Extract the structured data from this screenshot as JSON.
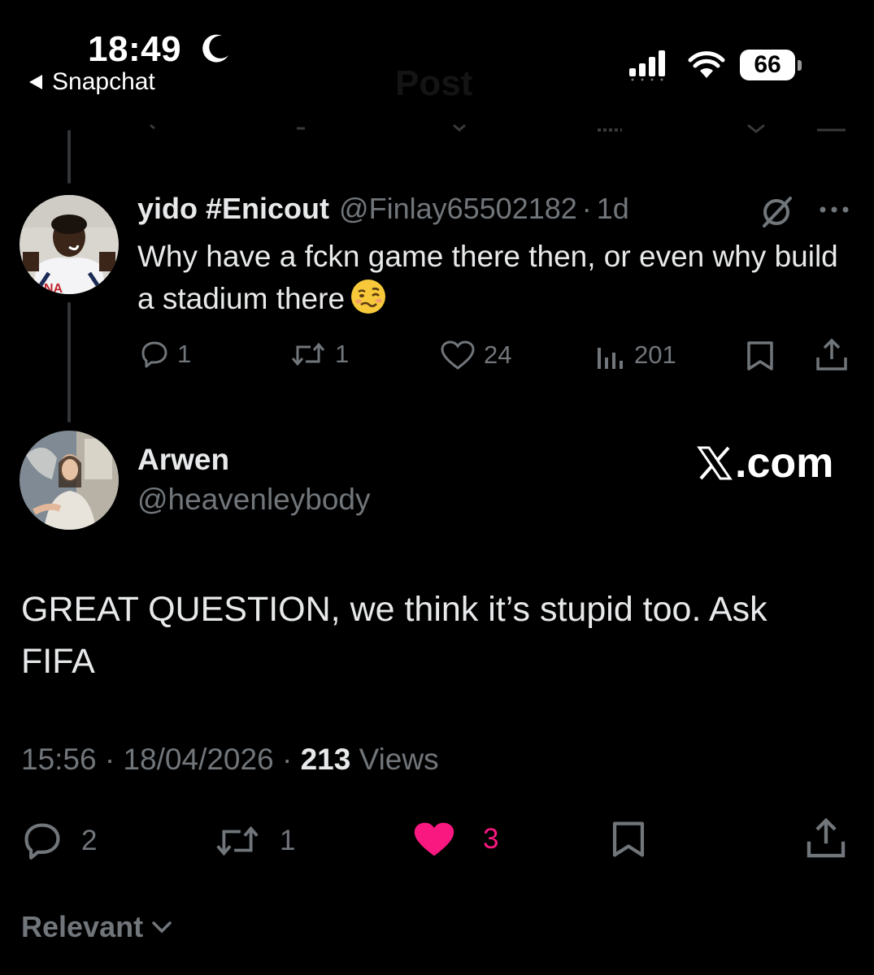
{
  "status_bar": {
    "time": "18:49",
    "back_app": "Snapchat",
    "battery": "66",
    "screen_title": "Post"
  },
  "reply": {
    "name": "yido #Enicout",
    "handle": "@Finlay65502182",
    "separator": "·",
    "time": "1d",
    "text": "Why have a fckn game there then, or even why build a stadium there",
    "emoji": "woozy-face-icon",
    "actions": {
      "replies": "1",
      "reposts": "1",
      "likes": "24",
      "views": "201"
    }
  },
  "post": {
    "name": "Arwen",
    "handle": "@heavenleybody",
    "watermark": ".com",
    "text": "GREAT QUESTION, we think it’s stupid too. Ask FIFA",
    "time": "15:56",
    "date": "18/04/2026",
    "views_count": "213",
    "views_label": "Views",
    "actions": {
      "replies": "2",
      "reposts": "1",
      "likes": "3"
    }
  },
  "sort": {
    "label": "Relevant"
  },
  "colors": {
    "background": "#000000",
    "text": "#e7e9ea",
    "secondary": "#71767b",
    "like_active": "#f91880",
    "thread_line": "#333639"
  }
}
